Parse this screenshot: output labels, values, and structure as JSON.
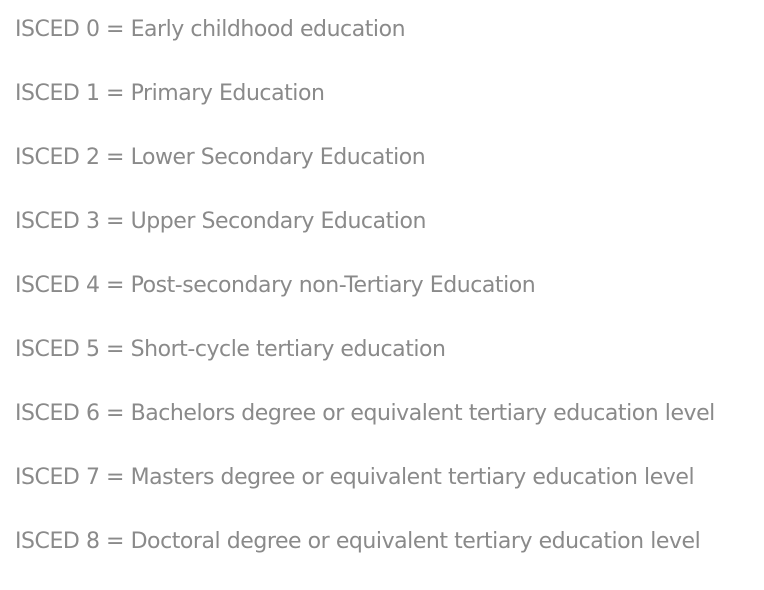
{
  "isced_levels": [
    "ISCED 0 = Early childhood education",
    "ISCED 1 = Primary Education",
    "ISCED 2 = Lower Secondary Education",
    "ISCED 3 = Upper Secondary Education",
    "ISCED 4 = Post-secondary non-Tertiary Education",
    "ISCED 5 = Short-cycle tertiary education",
    "ISCED 6 = Bachelors degree or equivalent tertiary education level",
    "ISCED 7 = Masters degree or equivalent tertiary education level",
    "ISCED 8 = Doctoral degree or equivalent tertiary education level"
  ]
}
